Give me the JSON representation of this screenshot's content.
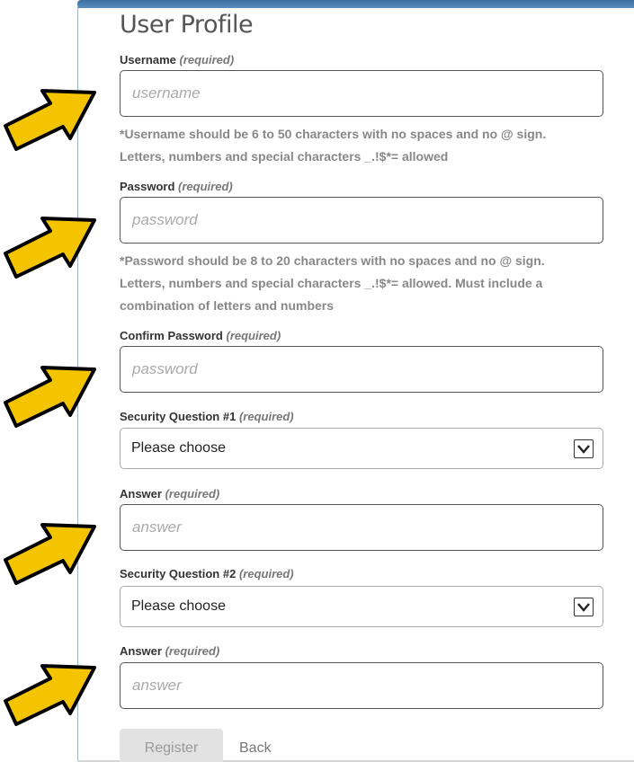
{
  "form": {
    "title": "User Profile",
    "required_tag": "(required)",
    "username": {
      "label": "Username",
      "placeholder": "username",
      "hint_line1": "*Username should be 6 to 50 characters with no spaces and no @ sign.",
      "hint_line2": "Letters, numbers and special characters _.!$*= allowed"
    },
    "password": {
      "label": "Password",
      "placeholder": "password",
      "hint_line1": "*Password should be 8 to 20 characters with no spaces and no @ sign.",
      "hint_line2": "Letters, numbers and special characters _.!$*= allowed. Must include a",
      "hint_line3": "combination of letters and numbers"
    },
    "confirm_password": {
      "label": "Confirm Password",
      "placeholder": "password"
    },
    "security_q1": {
      "label": "Security Question #1",
      "selected": "Please choose"
    },
    "answer1": {
      "label": "Answer",
      "placeholder": "answer"
    },
    "security_q2": {
      "label": "Security Question #2",
      "selected": "Please choose"
    },
    "answer2": {
      "label": "Answer",
      "placeholder": "answer"
    },
    "register_label": "Register",
    "back_label": "Back"
  },
  "annotations": {
    "arrow_color": "#f5c400",
    "arrow_outline": "#000000",
    "arrow_icon": "arrow-pointing-right-up"
  }
}
